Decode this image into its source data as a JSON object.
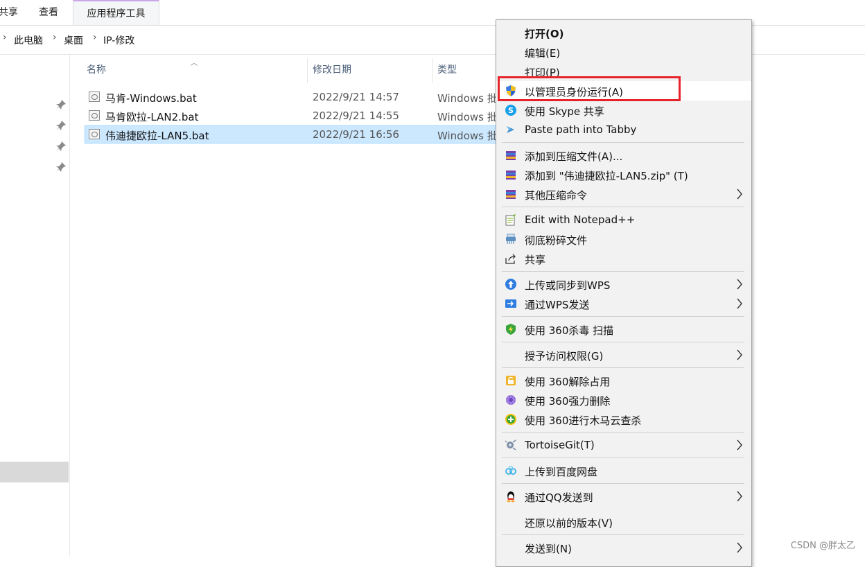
{
  "ribbon": {
    "tabs": [
      {
        "label": "共享"
      },
      {
        "label": "查看"
      },
      {
        "label": "应用程序工具"
      }
    ]
  },
  "breadcrumb": [
    "此电脑",
    "桌面",
    "IP-修改"
  ],
  "list": {
    "headers": {
      "name": "名称",
      "date": "修改日期",
      "type": "类型"
    },
    "files": [
      {
        "name": "马肯-Windows.bat",
        "date": "2022/9/21 14:57",
        "type": "Windows 批",
        "selected": false
      },
      {
        "name": "马肯欧拉-LAN2.bat",
        "date": "2022/9/21 14:55",
        "type": "Windows 批",
        "selected": false
      },
      {
        "name": "伟迪捷欧拉-LAN5.bat",
        "date": "2022/9/21 16:56",
        "type": "Windows 批",
        "selected": true
      }
    ]
  },
  "menu": {
    "items": [
      {
        "label": "打开(O)",
        "bold": true,
        "icon": "",
        "submenu": false
      },
      {
        "label": "编辑(E)",
        "icon": "",
        "submenu": false
      },
      {
        "label": "打印(P)",
        "icon": "",
        "submenu": false
      },
      {
        "label": "以管理员身份运行(A)",
        "icon": "uac-shield-icon",
        "submenu": false,
        "highlighted": true
      },
      {
        "label": "使用 Skype 共享",
        "icon": "skype-icon",
        "submenu": false
      },
      {
        "label": "Paste path into Tabby",
        "icon": "tabby-icon",
        "submenu": false
      },
      {
        "label": "添加到压缩文件(A)...",
        "icon": "winrar-icon",
        "submenu": false
      },
      {
        "label": "添加到 \"伟迪捷欧拉-LAN5.zip\" (T)",
        "icon": "winrar-icon",
        "submenu": false
      },
      {
        "label": "其他压缩命令",
        "icon": "winrar-icon",
        "submenu": true
      },
      {
        "label": "Edit with Notepad++",
        "icon": "notepadpp-icon",
        "submenu": false
      },
      {
        "label": "彻底粉碎文件",
        "icon": "shredder-icon",
        "submenu": false
      },
      {
        "label": "共享",
        "icon": "share-icon",
        "submenu": false
      },
      {
        "label": "上传或同步到WPS",
        "icon": "wps-cloud-icon",
        "submenu": true
      },
      {
        "label": "通过WPS发送",
        "icon": "wps-send-icon",
        "submenu": true
      },
      {
        "label": "使用 360杀毒 扫描",
        "icon": "360-antivirus-icon",
        "submenu": false
      },
      {
        "label": "授予访问权限(G)",
        "icon": "",
        "submenu": true
      },
      {
        "label": "使用 360解除占用",
        "icon": "360-unlock-icon",
        "submenu": false
      },
      {
        "label": "使用 360强力删除",
        "icon": "360-delete-icon",
        "submenu": false
      },
      {
        "label": "使用 360进行木马云查杀",
        "icon": "360-trojan-icon",
        "submenu": false
      },
      {
        "label": "TortoiseGit(T)",
        "icon": "tortoisegit-icon",
        "submenu": true
      },
      {
        "label": "上传到百度网盘",
        "icon": "baidu-netdisk-icon",
        "submenu": false
      },
      {
        "label": "通过QQ发送到",
        "icon": "qq-icon",
        "submenu": true
      },
      {
        "label": "还原以前的版本(V)",
        "icon": "",
        "submenu": false
      },
      {
        "label": "发送到(N)",
        "icon": "",
        "submenu": true
      }
    ]
  },
  "watermark": "CSDN @胖太乙",
  "colors": {
    "highlight_box": "#e6232a",
    "selection": "#cce8ff"
  }
}
